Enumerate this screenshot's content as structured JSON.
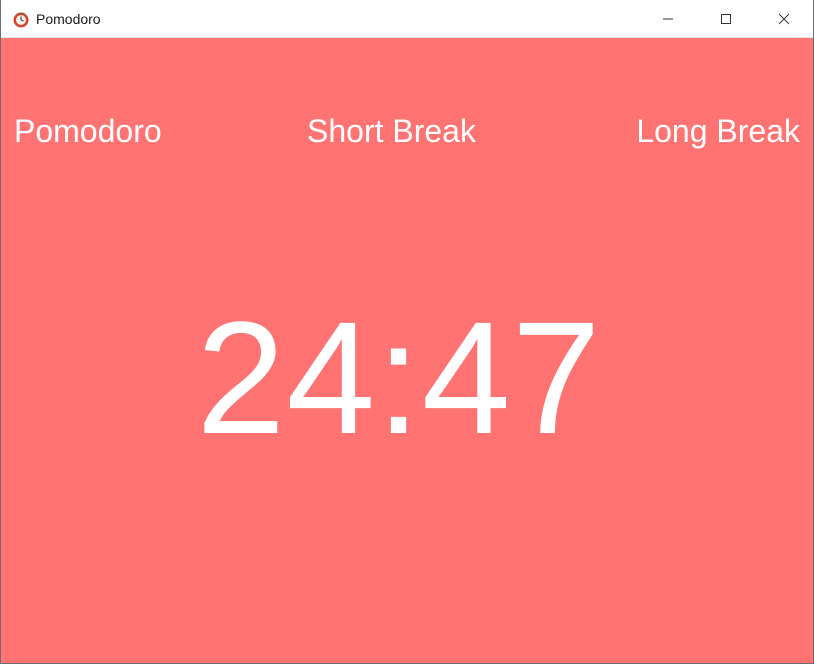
{
  "window": {
    "title": "Pomodoro",
    "app_icon": "tomato-timer-icon",
    "controls": {
      "minimize": "minimize-icon",
      "maximize": "maximize-icon",
      "close": "close-icon"
    }
  },
  "tabs": [
    {
      "label": "Pomodoro"
    },
    {
      "label": "Short Break"
    },
    {
      "label": "Long Break"
    }
  ],
  "timer": {
    "display": "24:47"
  },
  "colors": {
    "background": "#ff7373",
    "text": "#ffffff",
    "titlebar": "#ffffff"
  }
}
